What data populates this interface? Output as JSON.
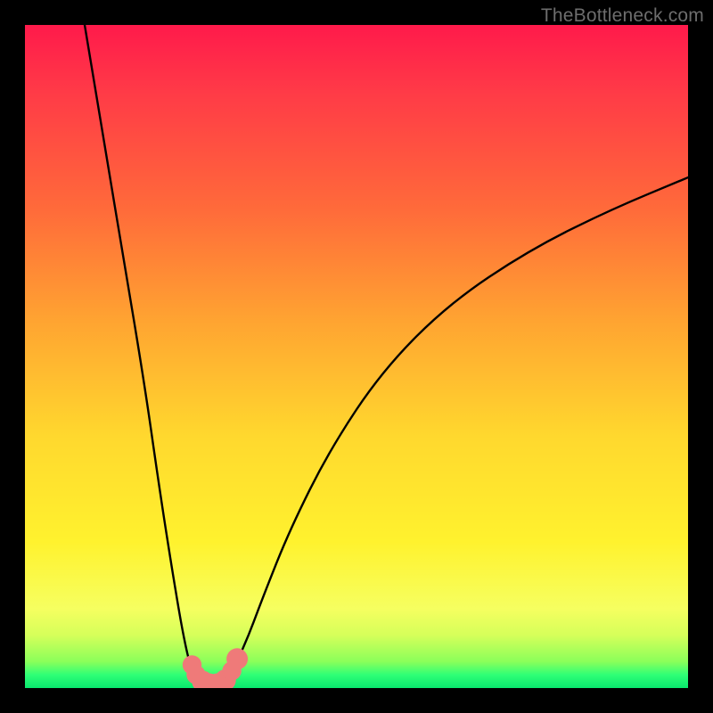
{
  "watermark": "TheBottleneck.com",
  "chart_data": {
    "type": "line",
    "title": "",
    "xlabel": "",
    "ylabel": "",
    "xlim": [
      0,
      100
    ],
    "ylim": [
      0,
      100
    ],
    "background_gradient": [
      "#ff1a4b",
      "#ff6b3a",
      "#ffd82e",
      "#09e86e"
    ],
    "series": [
      {
        "name": "left-branch",
        "x": [
          9,
          12,
          15,
          18,
          20,
          22,
          23.5,
          24.5,
          25.3,
          26
        ],
        "y": [
          100,
          82,
          64,
          46,
          32,
          19,
          10,
          5,
          2.2,
          1
        ]
      },
      {
        "name": "bottom-arc",
        "x": [
          26,
          26.8,
          27.6,
          28.6,
          29.6,
          30.4,
          31
        ],
        "y": [
          1,
          0.4,
          0.2,
          0.2,
          0.4,
          1,
          2
        ]
      },
      {
        "name": "right-branch",
        "x": [
          31,
          33,
          36,
          40,
          46,
          54,
          64,
          76,
          88,
          100
        ],
        "y": [
          2,
          6,
          14,
          24,
          36,
          48,
          58,
          66,
          72,
          77
        ]
      }
    ],
    "markers": {
      "name": "highlight-points",
      "color": "#ef7a79",
      "points": [
        {
          "x": 25.2,
          "y": 3.5,
          "r": 1.0
        },
        {
          "x": 25.8,
          "y": 2.0,
          "r": 1.0
        },
        {
          "x": 26.8,
          "y": 1.0,
          "r": 1.2
        },
        {
          "x": 27.8,
          "y": 0.6,
          "r": 1.2
        },
        {
          "x": 29.0,
          "y": 0.6,
          "r": 1.2
        },
        {
          "x": 30.2,
          "y": 1.2,
          "r": 1.2
        },
        {
          "x": 31.2,
          "y": 2.6,
          "r": 1.0
        },
        {
          "x": 32.0,
          "y": 4.4,
          "r": 1.2
        }
      ]
    }
  }
}
